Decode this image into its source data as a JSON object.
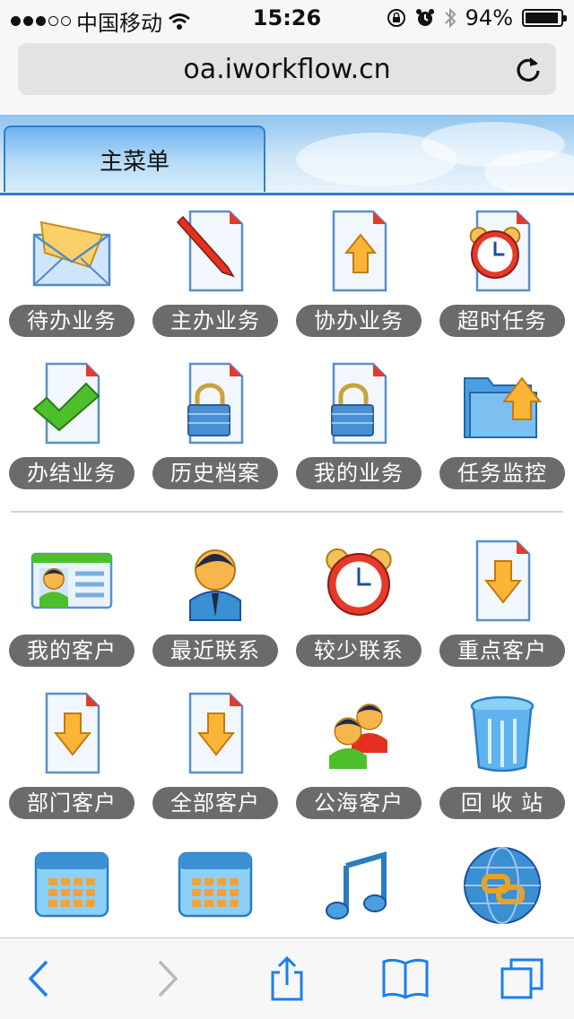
{
  "status_bar": {
    "carrier": "中国移动",
    "time": "15:26",
    "battery_percent": "94%",
    "battery_level": 0.94,
    "icons": [
      "signal-dots-icon",
      "wifi-icon",
      "orientation-lock-icon",
      "alarm-icon",
      "bluetooth-icon",
      "battery-icon"
    ]
  },
  "browser": {
    "url": "oa.iworkflow.cn",
    "reload_icon": "reload-icon"
  },
  "menu": {
    "tab_label": "主菜单"
  },
  "tasks": [
    {
      "label": "待办业务",
      "icon": "envelope-icon"
    },
    {
      "label": "主办业务",
      "icon": "pencil-document-icon"
    },
    {
      "label": "协办业务",
      "icon": "upload-document-icon"
    },
    {
      "label": "超时任务",
      "icon": "alarm-clock-document-icon"
    },
    {
      "label": "办结业务",
      "icon": "check-document-icon"
    },
    {
      "label": "历史档案",
      "icon": "locked-document-icon"
    },
    {
      "label": "我的业务",
      "icon": "locked-document-icon"
    },
    {
      "label": "任务监控",
      "icon": "folder-upload-icon"
    }
  ],
  "customers": [
    {
      "label": "我的客户",
      "icon": "contact-card-icon"
    },
    {
      "label": "最近联系",
      "icon": "business-person-icon"
    },
    {
      "label": "较少联系",
      "icon": "alarm-clock-icon"
    },
    {
      "label": "重点客户",
      "icon": "download-document-icon"
    },
    {
      "label": "部门客户",
      "icon": "download-document-icon"
    },
    {
      "label": "全部客户",
      "icon": "download-document-icon"
    },
    {
      "label": "公海客户",
      "icon": "people-group-icon"
    },
    {
      "label": "回 收 站",
      "icon": "recycle-bin-icon"
    },
    {
      "label": "",
      "icon": "calendar-icon"
    },
    {
      "label": "",
      "icon": "calendar-icon"
    },
    {
      "label": "",
      "icon": "music-note-icon"
    },
    {
      "label": "",
      "icon": "globe-link-icon"
    }
  ],
  "toolbar": {
    "items": [
      "back-icon",
      "forward-icon",
      "share-icon",
      "bookmarks-icon",
      "tabs-icon"
    ]
  }
}
